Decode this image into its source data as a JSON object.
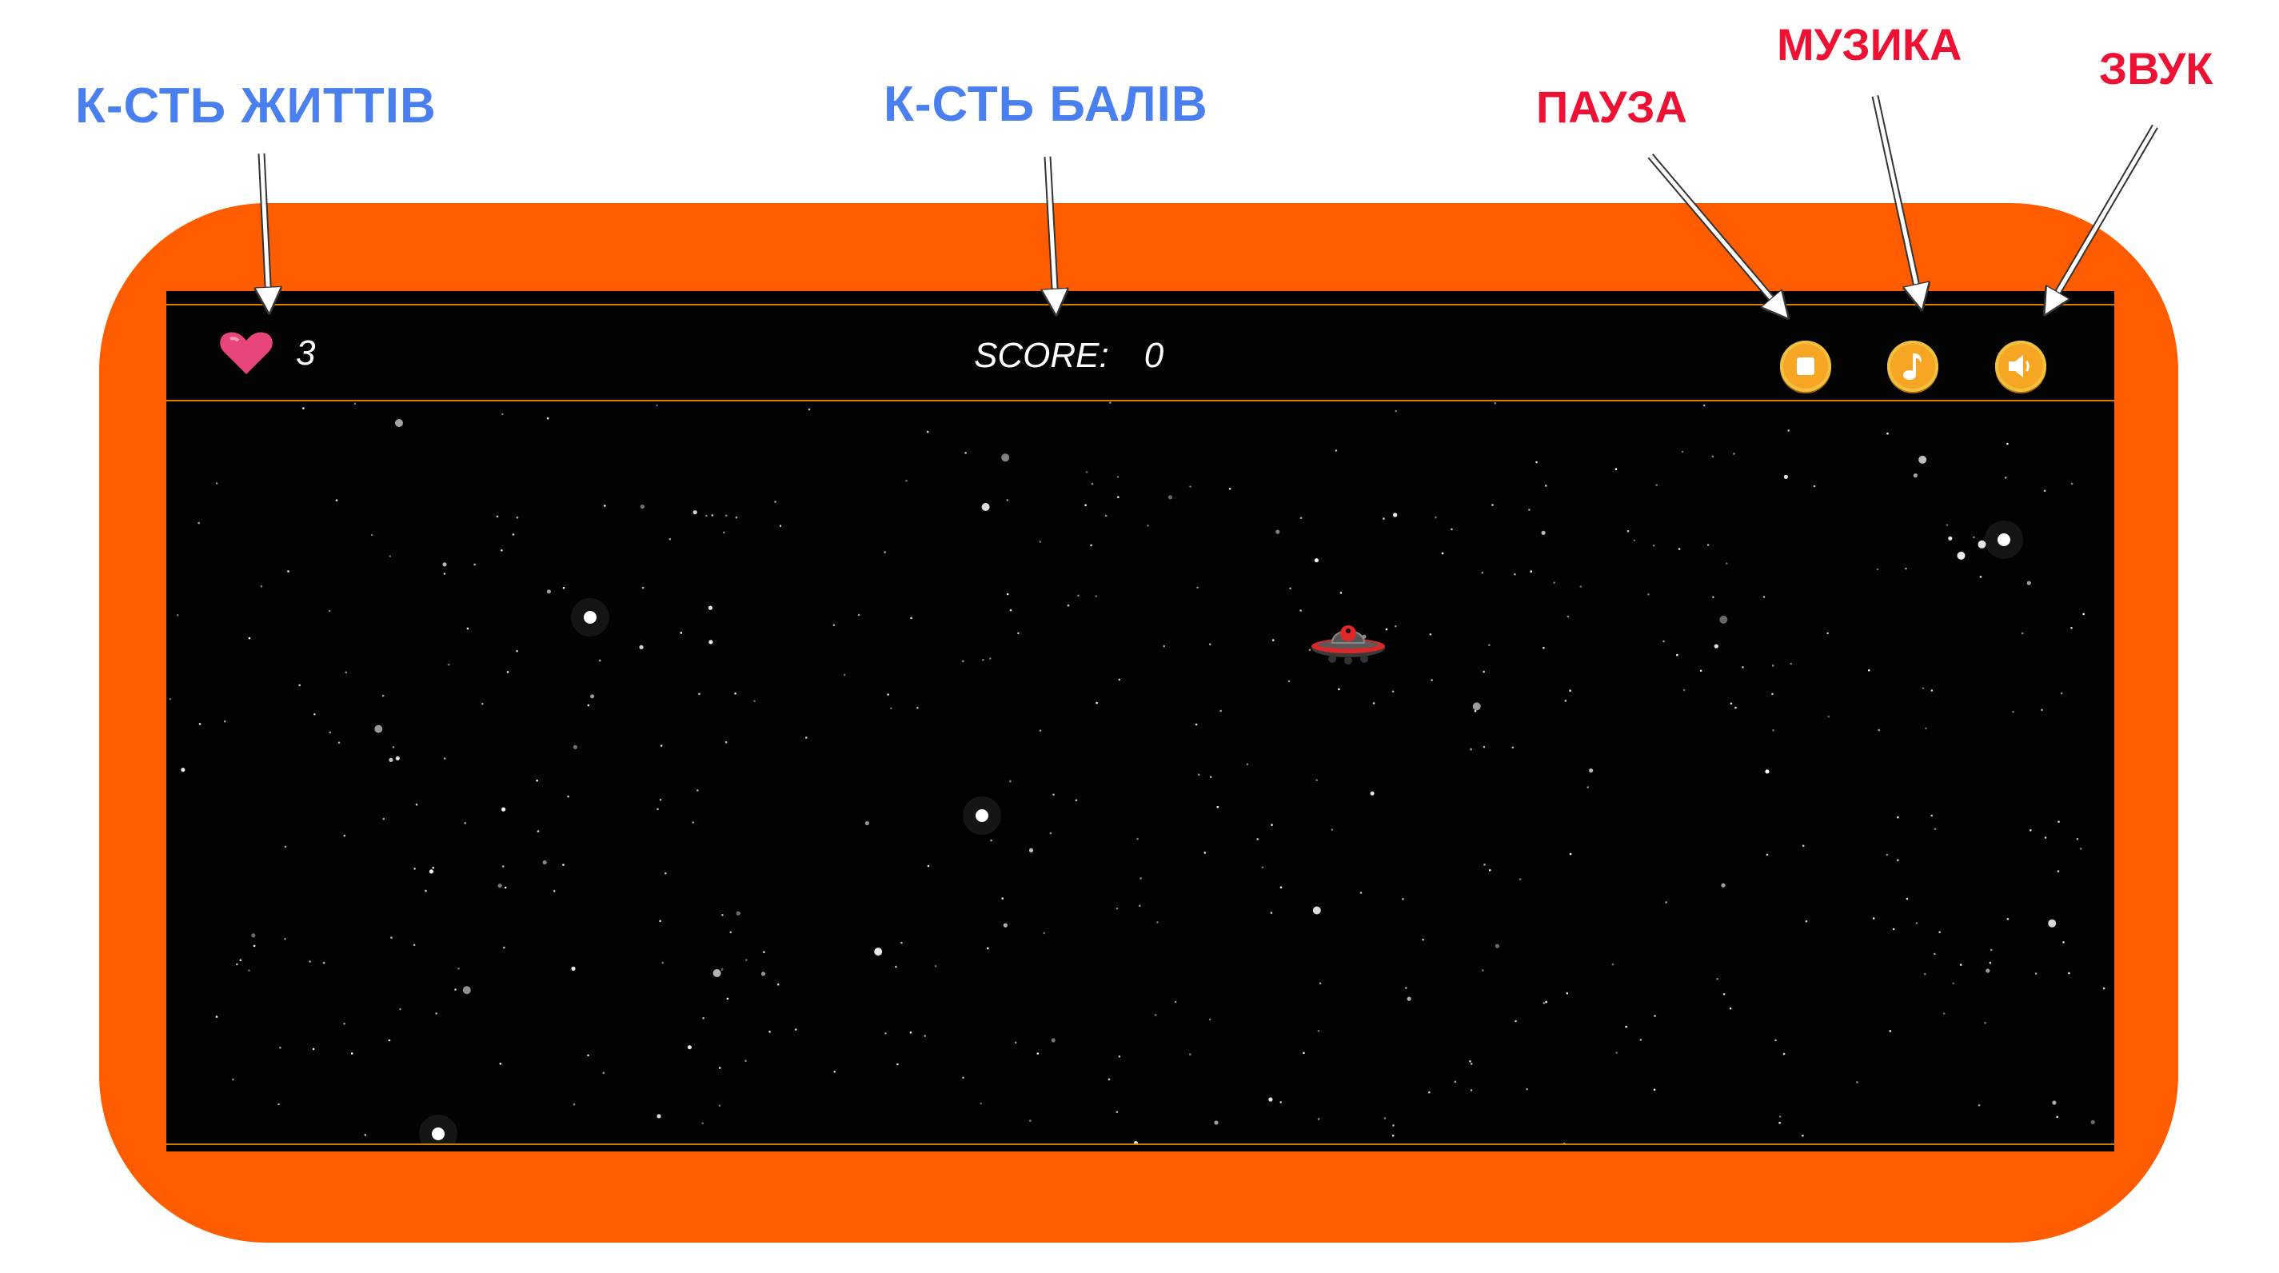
{
  "annotations": {
    "lives": "К-СТЬ ЖИТТІВ",
    "score": "К-СТЬ БАЛІВ",
    "pause": "ПАУЗА",
    "music": "МУЗИКА",
    "sound": "ЗВУК"
  },
  "hud": {
    "lives": "3",
    "score_label": "SCORE:",
    "score_value": "0"
  },
  "icons": {
    "lives": "heart-icon",
    "pause": "stop-icon",
    "music": "music-note-icon",
    "sound": "speaker-icon",
    "player": "ufo-icon"
  },
  "colors": {
    "annotation_blue": "#4a7ff0",
    "annotation_red": "#ee1133",
    "frame_orange": "#ff5c00",
    "hud_border": "#d97a00",
    "button_gold": "#f6a623",
    "heart_pink": "#e8467a",
    "space_black": "#020202"
  }
}
